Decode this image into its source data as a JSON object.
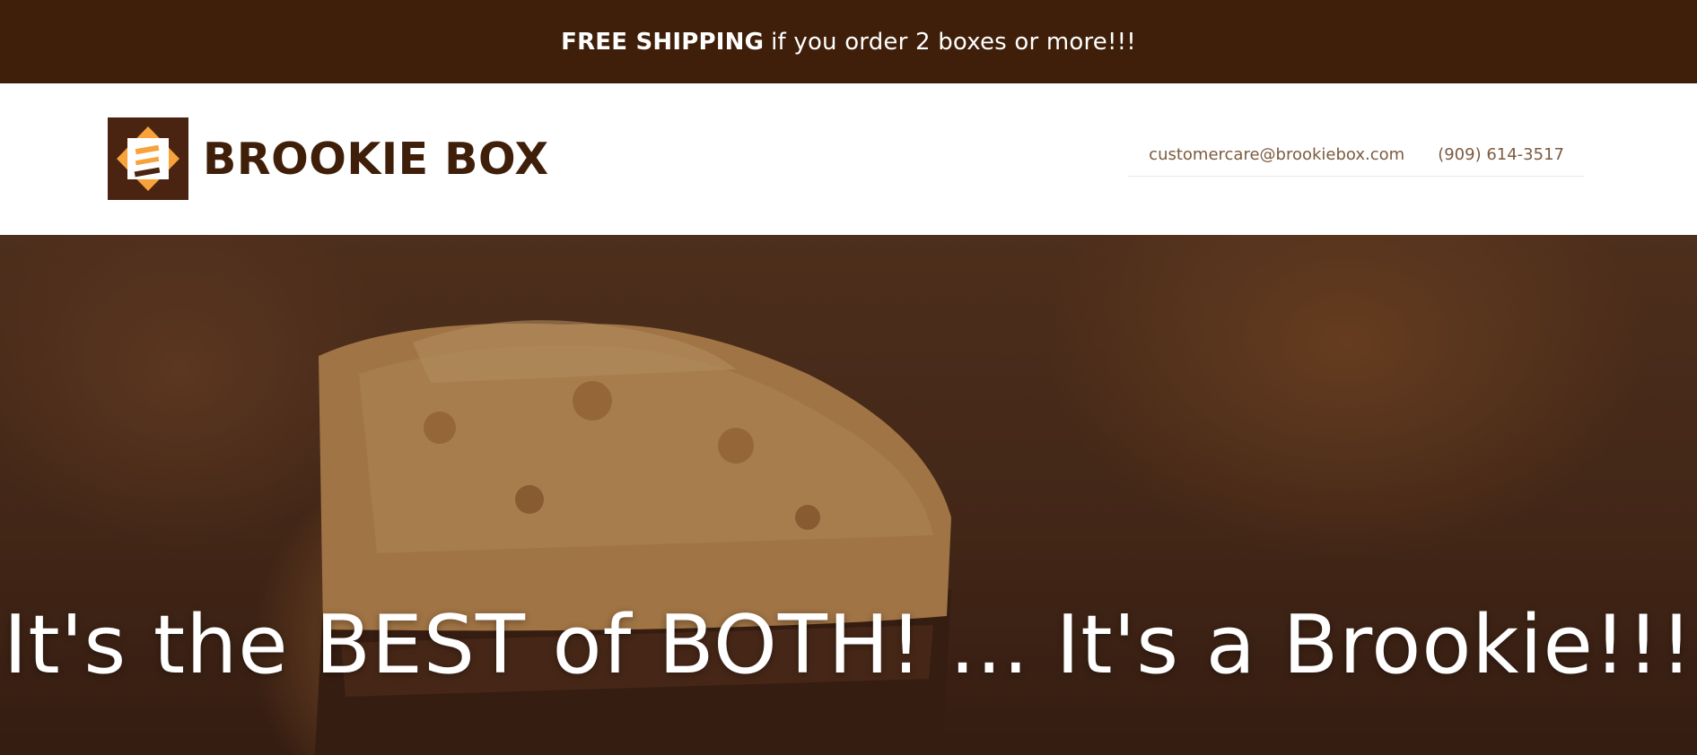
{
  "announcement": {
    "bold": "FREE SHIPPING",
    "rest": "if you order 2 boxes or more!!!"
  },
  "header": {
    "brand": "BROOKIE BOX",
    "email": "customercare@brookiebox.com",
    "phone": "(909) 614-3517"
  },
  "hero": {
    "headline": "It's the BEST of BOTH! ... It's a Brookie!!!"
  },
  "colors": {
    "brand_dark": "#3f1f09",
    "accent": "#f7a23b",
    "contact_text": "#7b5b3f"
  },
  "icons": {
    "logo": "brookie-box-logo-icon"
  }
}
